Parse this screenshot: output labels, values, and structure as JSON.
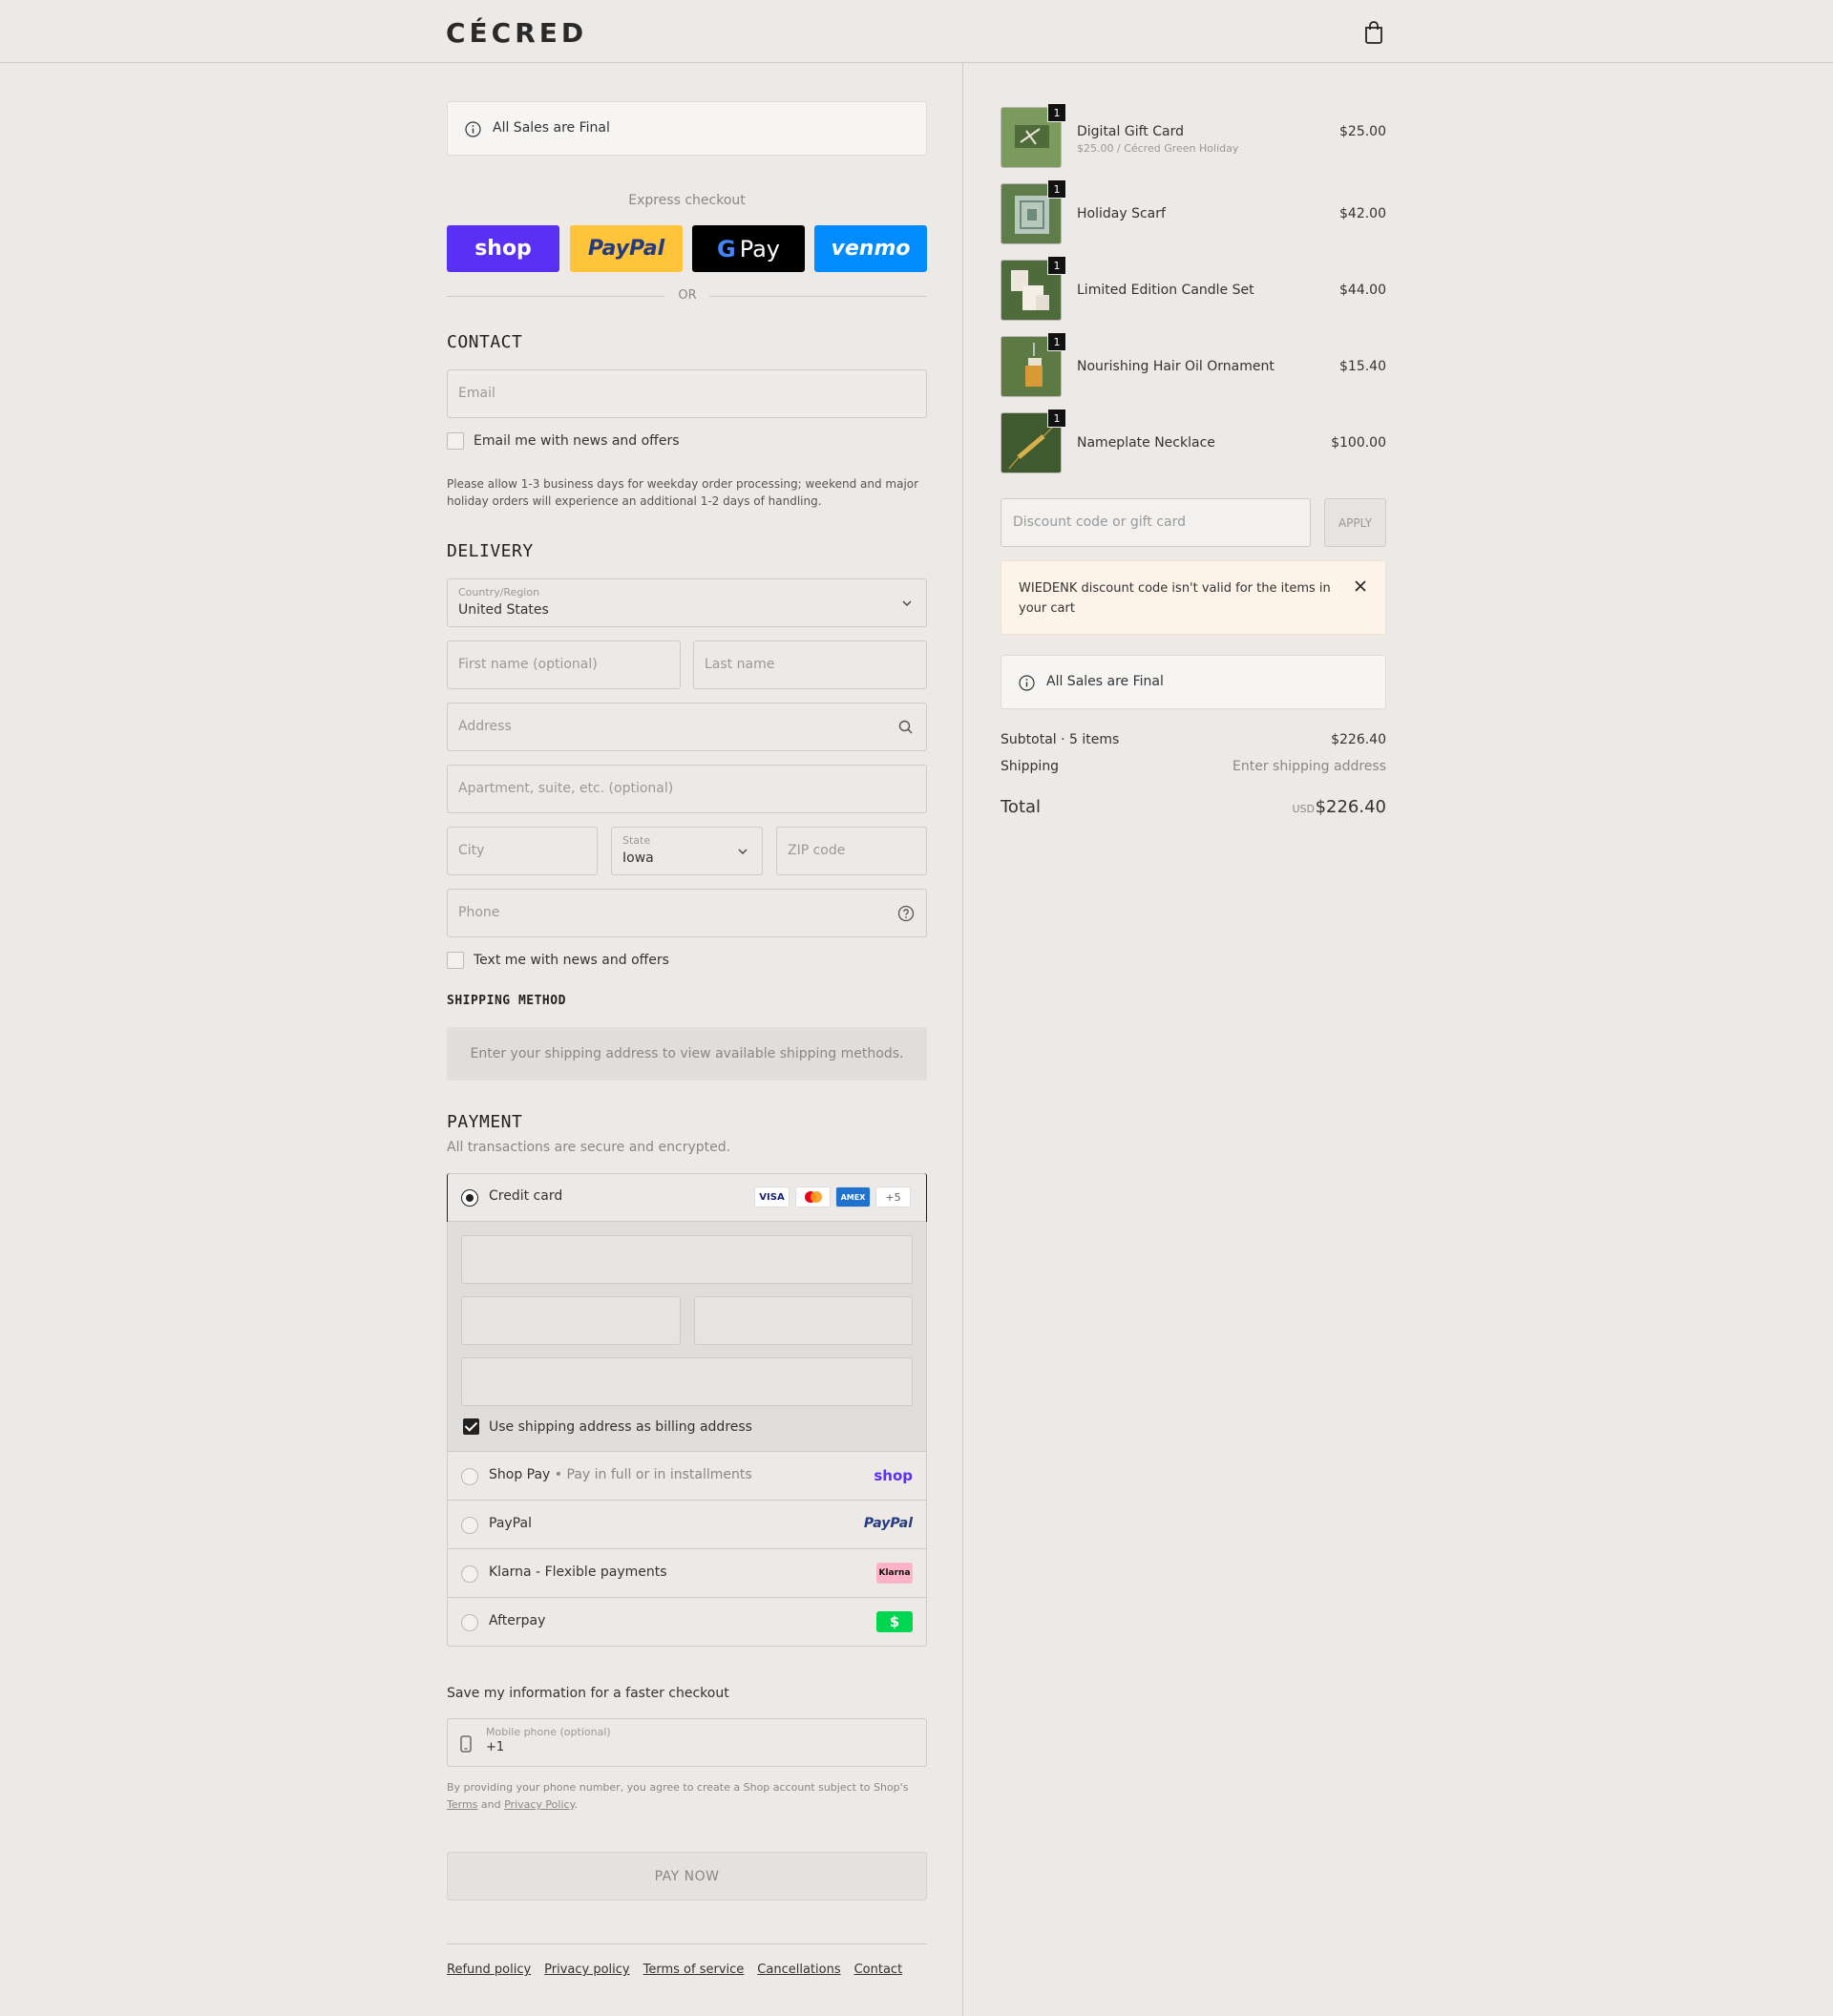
{
  "header": {
    "logo": "CÉCRED",
    "cart_icon": "shopping-bag-icon"
  },
  "notice": {
    "text": "All Sales are Final"
  },
  "express": {
    "label": "Express checkout",
    "buttons": [
      {
        "id": "shop",
        "label": "shop"
      },
      {
        "id": "paypal",
        "label": "PayPal"
      },
      {
        "id": "gpay",
        "label": "Pay",
        "mark": "G"
      },
      {
        "id": "venmo",
        "label": "venmo"
      }
    ],
    "or": "OR"
  },
  "contact": {
    "title": "CONTACT",
    "email_placeholder": "Email",
    "email_optin": "Email me with news and offers",
    "note": "Please allow 1-3 business days for weekday order processing; weekend and major holiday orders will experience an additional 1-2 days of handling."
  },
  "delivery": {
    "title": "DELIVERY",
    "country_label": "Country/Region",
    "country_value": "United States",
    "first_name": "First name (optional)",
    "last_name": "Last name",
    "address": "Address",
    "apartment": "Apartment, suite, etc. (optional)",
    "city": "City",
    "state_label": "State",
    "state_value": "Iowa",
    "zip": "ZIP code",
    "phone": "Phone",
    "sms_optin": "Text me with news and offers"
  },
  "shipping_method": {
    "title": "SHIPPING METHOD",
    "message": "Enter your shipping address to view available shipping methods."
  },
  "payment": {
    "title": "PAYMENT",
    "subtitle": "All transactions are secure and encrypted.",
    "credit_card": "Credit card",
    "card_brands": [
      "VISA",
      "",
      "AMEX",
      "+5"
    ],
    "billing_same": "Use shipping address as billing address",
    "shop_pay": "Shop Pay",
    "shop_pay_sub": "Pay in full or in installments",
    "shop_pay_brand": "shop",
    "paypal": "PayPal",
    "paypal_brand": "PayPal",
    "klarna": "Klarna - Flexible payments",
    "klarna_brand": "Klarna",
    "afterpay": "Afterpay",
    "afterpay_brand": "$"
  },
  "save_info": {
    "title": "Save my information for a faster checkout",
    "mobile_label": "Mobile phone (optional)",
    "mobile_value": "+1",
    "legal_prefix": "By providing your phone number, you agree to create a Shop account subject to Shop's",
    "terms": "Terms",
    "and": "and",
    "privacy": "Privacy Policy"
  },
  "pay_now": "PAY NOW",
  "footer_links": [
    "Refund policy",
    "Privacy policy",
    "Terms of service",
    "Cancellations",
    "Contact"
  ],
  "cart": {
    "items": [
      {
        "name": "Digital Gift Card",
        "sub": "$25.00 / Cécred Green Holiday",
        "price": "$25.00",
        "qty": "1"
      },
      {
        "name": "Holiday Scarf",
        "price": "$42.00",
        "qty": "1"
      },
      {
        "name": "Limited Edition Candle Set",
        "price": "$44.00",
        "qty": "1"
      },
      {
        "name": "Nourishing Hair Oil Ornament",
        "price": "$15.40",
        "qty": "1"
      },
      {
        "name": "Nameplate Necklace",
        "price": "$100.00",
        "qty": "1"
      }
    ],
    "discount_placeholder": "Discount code or gift card",
    "apply": "APPLY",
    "error": "WIEDENK discount code isn't valid for the items in your cart",
    "notice": "All Sales are Final",
    "subtotal_label": "Subtotal · 5 items",
    "subtotal_value": "$226.40",
    "shipping_label": "Shipping",
    "shipping_value": "Enter shipping address",
    "total_label": "Total",
    "currency": "USD",
    "total_value": "$226.40"
  },
  "colors": {
    "background": "#ece9e6",
    "shop_purple": "#5a31f4",
    "paypal_yellow": "#ffc439",
    "venmo_blue": "#008cff",
    "error_bg": "#fdf3e8"
  }
}
